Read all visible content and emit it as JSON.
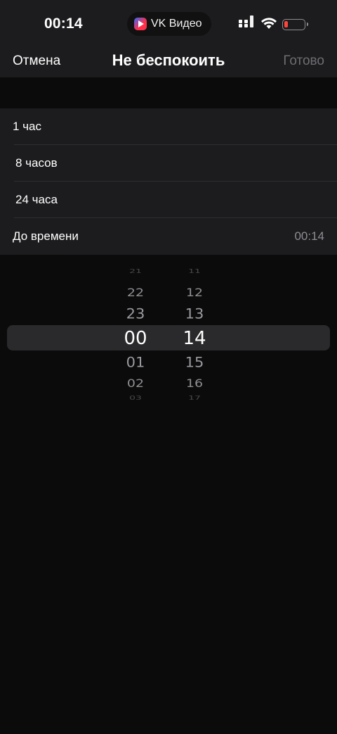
{
  "status_bar": {
    "time": "00:14",
    "app_name": "VK Видео",
    "icons": [
      "signal-icon",
      "wifi-icon",
      "battery-icon"
    ],
    "battery_color": "#ff453a"
  },
  "nav": {
    "cancel_label": "Отмена",
    "title": "Не беспокоить",
    "done_label": "Готово"
  },
  "options": [
    {
      "label": "1 час"
    },
    {
      "label": "8 часов"
    },
    {
      "label": "24 часа"
    },
    {
      "label": "До времени",
      "value": "00:14"
    }
  ],
  "picker": {
    "hours": [
      "21",
      "22",
      "23",
      "00",
      "01",
      "02",
      "03"
    ],
    "minutes": [
      "11",
      "12",
      "13",
      "14",
      "15",
      "16",
      "17"
    ],
    "selected_hour": "00",
    "selected_minute": "14"
  },
  "colors": {
    "background": "#0b0b0b",
    "surface": "#1c1c1e",
    "secondary_text": "#8e8e93"
  }
}
